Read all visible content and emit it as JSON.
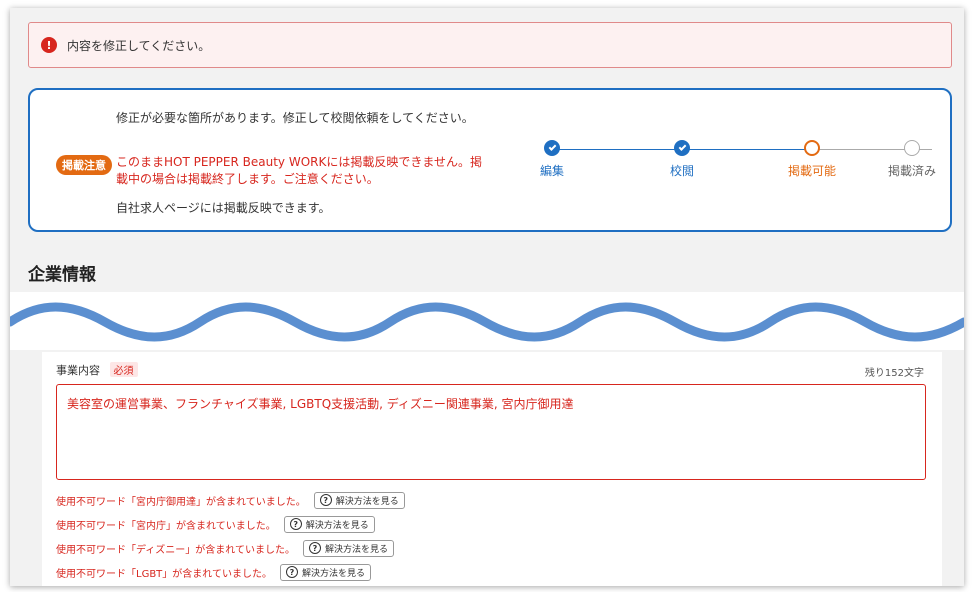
{
  "error_banner": {
    "icon": "exclamation-icon",
    "text": "内容を修正してください。"
  },
  "status": {
    "message_1": "修正が必要な箇所があります。修正して校閲依頼をしてください。",
    "badge": "掲載注意",
    "warning": "このままHOT PEPPER Beauty WORKには掲載反映できません。掲載中の場合は掲載終了します。ご注意ください。",
    "message_3": "自社求人ページには掲載反映できます。",
    "steps": [
      {
        "label": "編集",
        "state": "done"
      },
      {
        "label": "校閲",
        "state": "done"
      },
      {
        "label": "掲載可能",
        "state": "current"
      },
      {
        "label": "掲載済み",
        "state": "todo"
      }
    ]
  },
  "section": {
    "title": "企業情報"
  },
  "field": {
    "label": "事業内容",
    "required": "必須",
    "counter": "残り152文字",
    "value": "美容室の運営事業、フランチャイズ事業, LGBTQ支援活動, ディズニー関連事業, 宮内庁御用達"
  },
  "warnings": [
    {
      "text": "使用不可ワード「宮内庁御用達」が含まれていました。",
      "button": "解決方法を見る"
    },
    {
      "text": "使用不可ワード「宮内庁」が含まれていました。",
      "button": "解決方法を見る"
    },
    {
      "text": "使用不可ワード「ディズニー」が含まれていました。",
      "button": "解決方法を見る"
    },
    {
      "text": "使用不可ワード「LGBT」が含まれていました。",
      "button": "解決方法を見る"
    }
  ],
  "colors": {
    "primary": "#1f6fc2",
    "error": "#d7261e",
    "accent": "#e36a12"
  }
}
